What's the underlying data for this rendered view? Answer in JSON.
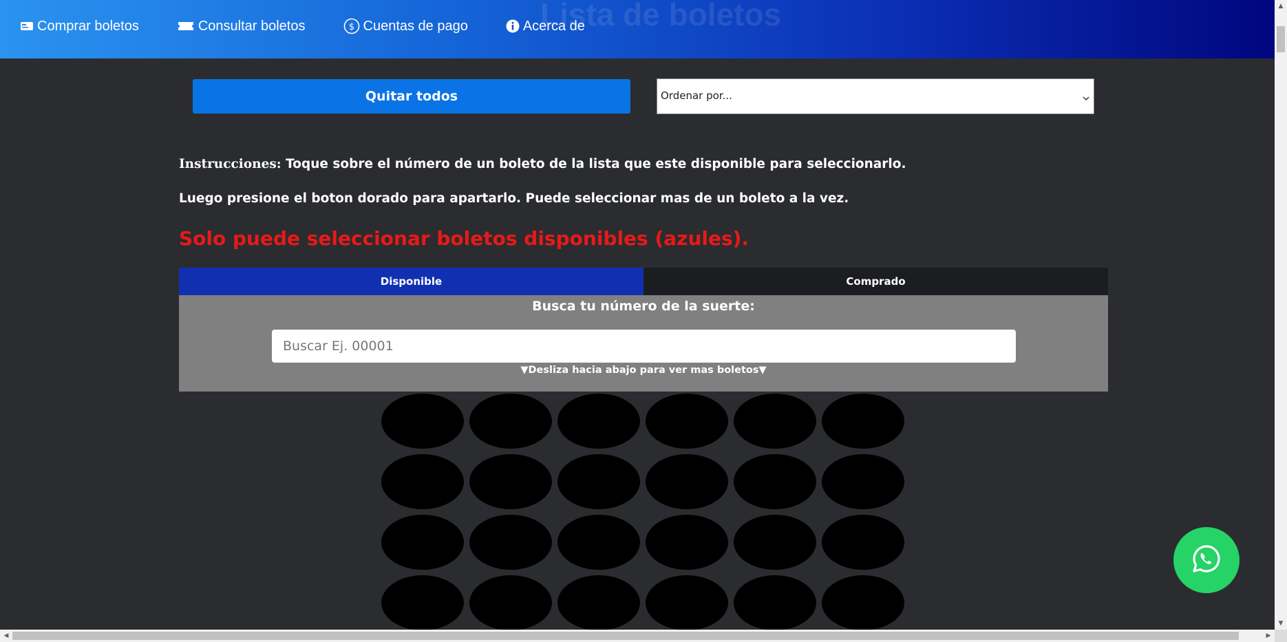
{
  "header": {
    "ghost_title": "Lista de boletos",
    "nav": [
      {
        "label": "Comprar boletos",
        "icon": "ticket-card-icon"
      },
      {
        "label": "Consultar boletos",
        "icon": "ticket-icon"
      },
      {
        "label": "Cuentas de pago",
        "icon": "dollar-coin-icon"
      },
      {
        "label": "Acerca de",
        "icon": "info-icon"
      }
    ]
  },
  "controls": {
    "remove_all_label": "Quitar todos",
    "sort_selected": "Ordenar por..."
  },
  "instructions": {
    "label": "Instrucciones:",
    "line1": "Toque sobre el número de un boleto de la lista que este disponible para seleccionarlo.",
    "line2": "Luego presione el boton dorado para apartarlo. Puede seleccionar mas de un boleto a la vez.",
    "warning": "Solo puede seleccionar boletos disponibles (azules)."
  },
  "legend_tabs": {
    "available": "Disponible",
    "purchased": "Comprado"
  },
  "search": {
    "title": "Busca tu número de la suerte:",
    "placeholder": "Buscar Ej. 00001",
    "hint": "▼Desliza hacia abajo para ver mas boletos▼"
  },
  "tickets": {
    "columns": 6,
    "count_visible": 24
  },
  "colors": {
    "available": "#1130b1",
    "purchased": "#1c1d20",
    "warning": "#e81919",
    "primary_button": "#0a74e6",
    "whatsapp": "#25d366"
  },
  "whatsapp": {
    "icon": "whatsapp-icon"
  }
}
